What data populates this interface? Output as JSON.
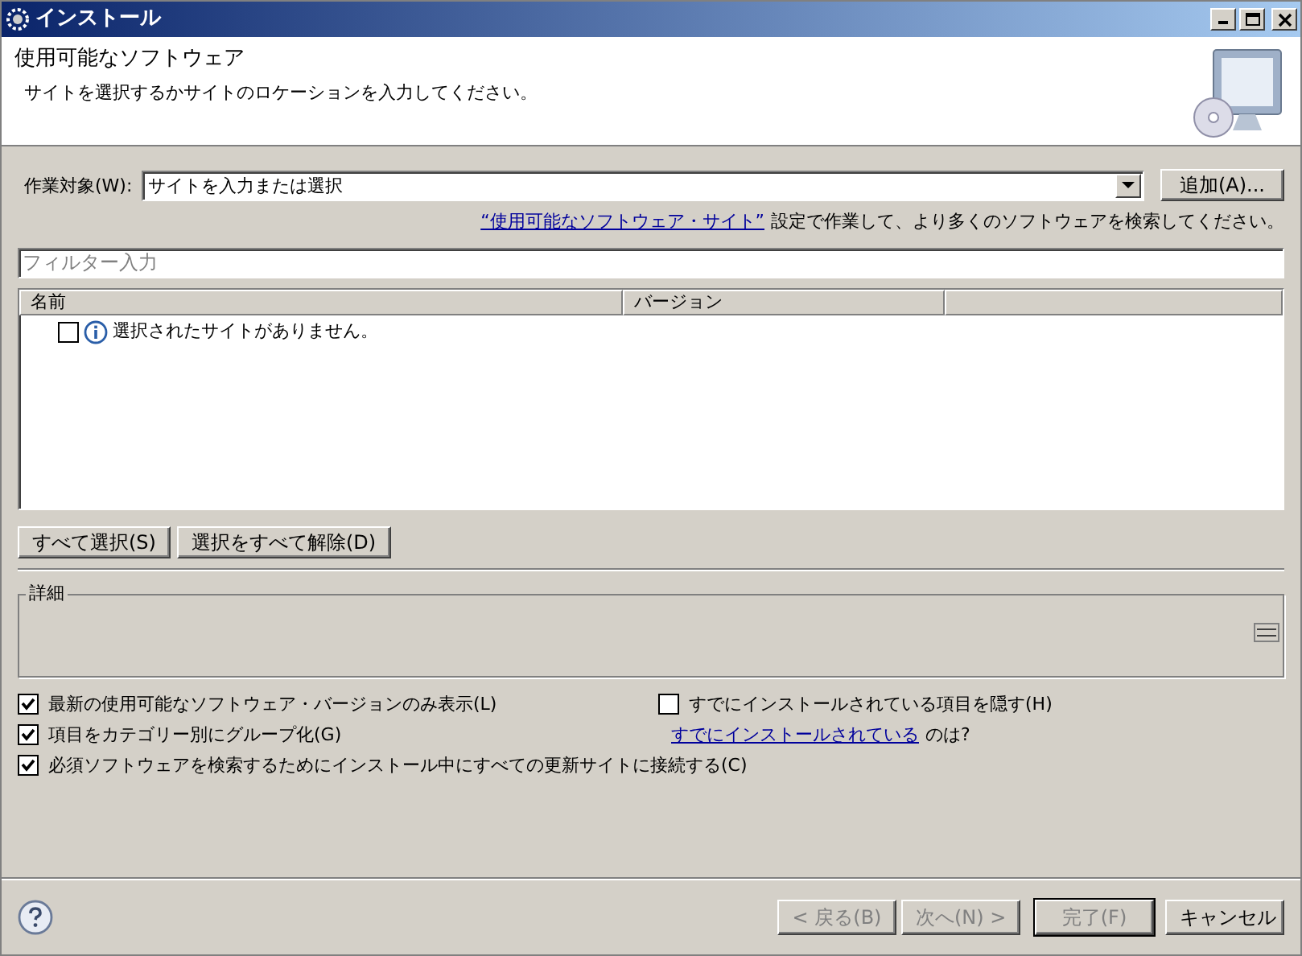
{
  "window": {
    "title": "インストール"
  },
  "header": {
    "title": "使用可能なソフトウェア",
    "description": "サイトを選択するかサイトのロケーションを入力してください。"
  },
  "work_target": {
    "label": "作業対象(W):",
    "value": "サイトを入力または選択",
    "add_button": "追加(A)..."
  },
  "hint": {
    "link": "“使用可能なソフトウェア・サイト”",
    "text": "設定で作業して、より多くのソフトウェアを検索してください。"
  },
  "filter": {
    "placeholder": "フィルター入力"
  },
  "tree": {
    "columns": [
      "名前",
      "バージョン"
    ],
    "rows": [
      {
        "label": "選択されたサイトがありません。",
        "checked": false
      }
    ]
  },
  "selection_buttons": [
    "すべて選択(S)",
    "選択をすべて解除(D)"
  ],
  "details": {
    "title": "詳細"
  },
  "options_left": [
    {
      "label": "最新の使用可能なソフトウェア・バージョンのみ表示(L)",
      "checked": true
    },
    {
      "label": "項目をカテゴリー別にグループ化(G)",
      "checked": true
    },
    {
      "label": "必須ソフトウェアを検索するためにインストール中にすべての更新サイトに接続する(C)",
      "checked": true
    }
  ],
  "options_right": [
    {
      "label": "すでにインストールされている項目を隠す(H)",
      "checked": false
    }
  ],
  "installed_hint": {
    "link": "すでにインストールされている",
    "text": "のは?"
  },
  "footer_buttons": [
    {
      "label": "< 戻る(B)",
      "disabled": true,
      "default": false
    },
    {
      "label": "次へ(N) >",
      "disabled": true,
      "default": false
    },
    {
      "label": "完了(F)",
      "disabled": true,
      "default": true
    },
    {
      "label": "キャンセル",
      "disabled": false,
      "default": false
    }
  ]
}
